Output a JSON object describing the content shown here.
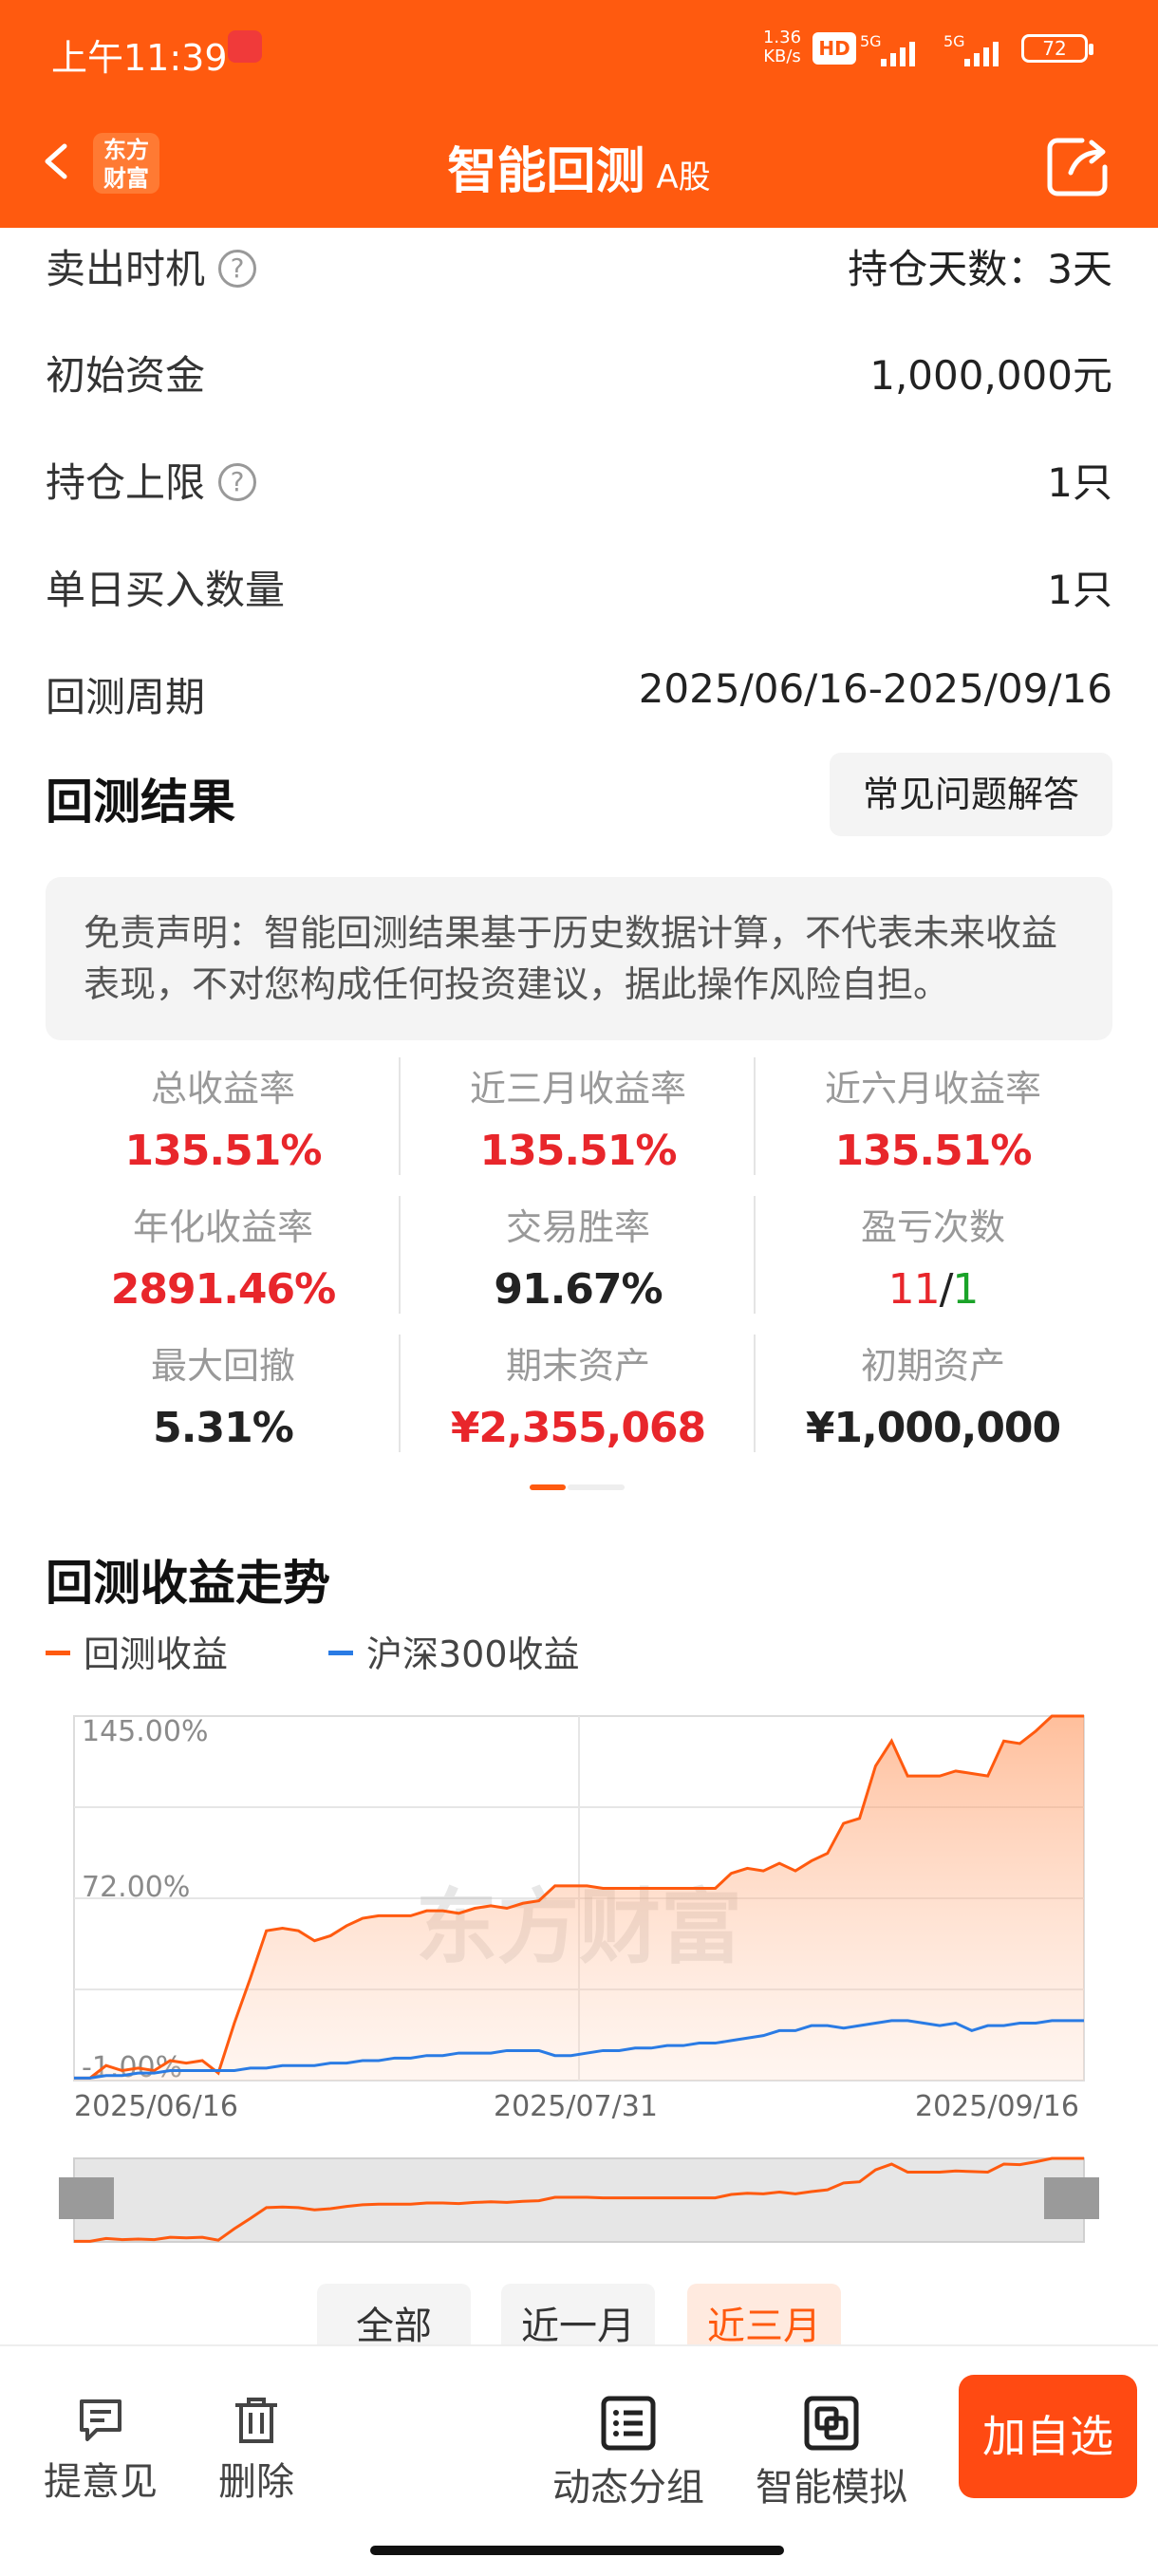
{
  "status_bar": {
    "time": "上午11:39",
    "net_speed_value": "1.36",
    "net_speed_unit": "KB/s",
    "hd": "HD",
    "sig1": "5G",
    "sig2": "5G",
    "battery": "72"
  },
  "nav": {
    "brand_line1": "东方",
    "brand_line2": "财富",
    "title": "智能回测",
    "title_sub": "A股"
  },
  "params": [
    {
      "label": "卖出时机",
      "help": true,
      "value": "持仓天数：3天"
    },
    {
      "label": "初始资金",
      "help": false,
      "value": "1,000,000元"
    },
    {
      "label": "持仓上限",
      "help": true,
      "value": "1只"
    },
    {
      "label": "单日买入数量",
      "help": false,
      "value": "1只"
    },
    {
      "label": "回测周期",
      "help": false,
      "value": "2025/06/16-2025/09/16"
    }
  ],
  "help_glyph": "?",
  "results": {
    "title": "回测结果",
    "faq_label": "常见问题解答",
    "disclaimer": "免责声明：智能回测结果基于历史数据计算，不代表未来收益表现，不对您构成任何投资建议，据此操作风险自担。",
    "stats": [
      {
        "label": "总收益率",
        "value": "135.51%",
        "color": "red"
      },
      {
        "label": "近三月收益率",
        "value": "135.51%",
        "color": "red"
      },
      {
        "label": "近六月收益率",
        "value": "135.51%",
        "color": "red"
      },
      {
        "label": "年化收益率",
        "value": "2891.46%",
        "color": "red"
      },
      {
        "label": "交易胜率",
        "value": "91.67%",
        "color": "black"
      },
      {
        "label": "盈亏次数",
        "value_win": "11",
        "sep": "/",
        "value_loss": "1"
      },
      {
        "label": "最大回撤",
        "value": "5.31%",
        "color": "black"
      },
      {
        "label": "期末资产",
        "value": "¥2,355,068",
        "color": "red"
      },
      {
        "label": "初期资产",
        "value": "¥1,000,000",
        "color": "black"
      }
    ]
  },
  "trend": {
    "title": "回测收益走势",
    "legend": [
      {
        "name": "回测收益",
        "color": "#ff5a0f"
      },
      {
        "name": "沪深300收益",
        "color": "#2a7be4"
      }
    ],
    "watermark": "东方财富",
    "range_buttons": [
      {
        "label": "全部",
        "active": false
      },
      {
        "label": "近一月",
        "active": false
      },
      {
        "label": "近三月",
        "active": true
      }
    ]
  },
  "chart_data": {
    "type": "area",
    "title": "",
    "xlabel": "",
    "ylabel": "",
    "y_tick_labels": [
      "145.00%",
      "72.00%",
      "-1.00%"
    ],
    "x_tick_labels": [
      "2025/06/16",
      "2025/07/31",
      "2025/09/16"
    ],
    "ylim": [
      -1,
      145
    ],
    "grid": true,
    "legend_position": "top-left",
    "x": [
      0,
      1,
      2,
      3,
      4,
      5,
      6,
      7,
      8,
      9,
      10,
      11,
      12,
      13,
      14,
      15,
      16,
      17,
      18,
      19,
      20,
      21,
      22,
      23,
      24,
      25,
      26,
      27,
      28,
      29,
      30,
      31,
      32,
      33,
      34,
      35,
      36,
      37,
      38,
      39,
      40,
      41,
      42,
      43,
      44,
      45,
      46,
      47,
      48,
      49,
      50,
      51,
      52,
      53,
      54,
      55,
      56,
      57,
      58,
      59,
      60,
      61,
      62,
      63
    ],
    "series": [
      {
        "name": "回测收益",
        "color": "#ff5a0f",
        "values": [
          0,
          0,
          5,
          3,
          4,
          3,
          7,
          6,
          7,
          2,
          22,
          40,
          59,
          60,
          59,
          55,
          57,
          61,
          64,
          65,
          65,
          65,
          67,
          67,
          66,
          68,
          69,
          68,
          70,
          71,
          77,
          77,
          77,
          76,
          76,
          76,
          76,
          76,
          76,
          76,
          76,
          82,
          84,
          83,
          86,
          83,
          87,
          90,
          102,
          104,
          125,
          135,
          121,
          121,
          121,
          123,
          122,
          121,
          135,
          134,
          139,
          145,
          145,
          145
        ]
      },
      {
        "name": "沪深300收益",
        "color": "#2a7be4",
        "values": [
          0,
          0,
          1,
          1,
          2,
          2,
          3,
          3,
          3,
          3,
          3,
          4,
          4,
          5,
          5,
          5,
          6,
          6,
          7,
          7,
          8,
          8,
          9,
          9,
          10,
          10,
          10,
          11,
          11,
          11,
          9,
          9,
          10,
          11,
          11,
          12,
          12,
          13,
          13,
          14,
          14,
          15,
          16,
          17,
          19,
          19,
          21,
          21,
          20,
          21,
          22,
          23,
          23,
          22,
          21,
          22,
          19,
          21,
          21,
          22,
          22,
          23,
          23,
          23
        ]
      }
    ]
  },
  "bottom_bar": {
    "items": [
      {
        "label": "提意见",
        "icon": "feedback-icon"
      },
      {
        "label": "删除",
        "icon": "trash-icon"
      },
      {
        "label": "动态分组",
        "icon": "list-icon"
      },
      {
        "label": "智能模拟",
        "icon": "simulate-icon"
      }
    ],
    "add_label": "加自选"
  }
}
